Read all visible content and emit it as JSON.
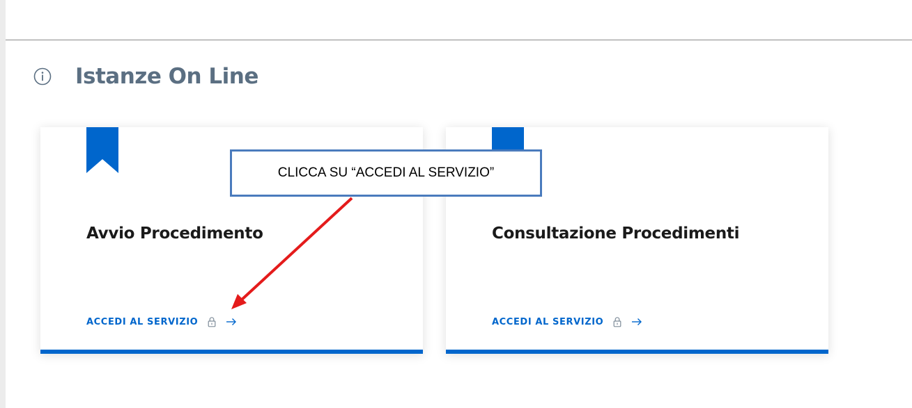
{
  "section": {
    "title": "Istanze On Line",
    "icon": "info-icon"
  },
  "cards": [
    {
      "title": "Avvio Procedimento",
      "link_label": "ACCEDI AL SERVIZIO"
    },
    {
      "title": "Consultazione Procedimenti",
      "link_label": "ACCEDI AL SERVIZIO"
    }
  ],
  "annotation": {
    "text": "CLICCA SU “ACCEDI AL SERVIZIO”"
  },
  "colors": {
    "accent": "#0066cc",
    "title_gray": "#5b6f82",
    "callout_border": "#4a7bbd",
    "annotation_arrow": "#e41b1b"
  }
}
